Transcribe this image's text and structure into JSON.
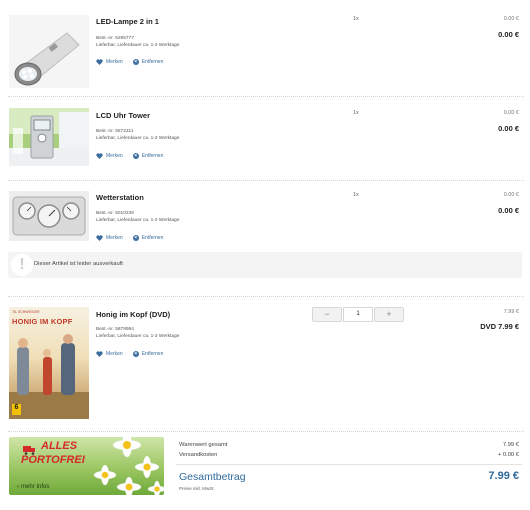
{
  "items": [
    {
      "title": "LED-Lampe 2 in 1",
      "order_no": "Best.-nr. 5285777",
      "delivery": "Lieferbar, Lieferdauer ca. 1-2 Werktage",
      "qty": "1x",
      "unit_price": "0.00 €",
      "total": "0.00 €"
    },
    {
      "title": "LCD Uhr Tower",
      "order_no": "Best.-nr. 5572311",
      "delivery": "Lieferbar, Lieferdauer ca. 1-2 Werktage",
      "qty": "1x",
      "unit_price": "0.00 €",
      "total": "0.00 €"
    },
    {
      "title": "Wetterstation",
      "order_no": "Best.-nr. 5010236",
      "delivery": "Lieferbar, Lieferdauer ca. 1-2 Werktage",
      "qty": "1x",
      "unit_price": "0.00 €",
      "total": "0.00 €"
    },
    {
      "title": "Honig im Kopf (DVD)",
      "order_no": "Best.-nr. 5878984",
      "delivery": "Lieferbar, Lieferdauer ca. 1-2 Werktage",
      "qty_value": "1",
      "unit_price": "7.99 €",
      "total": "DVD 7.99 €"
    }
  ],
  "actions": {
    "favorite": "Merken",
    "remove": "Entfernen"
  },
  "soldout_text": "Dieser Artikel ist leider ausverkauft",
  "stepper": {
    "minus": "−",
    "plus": "+"
  },
  "dvd_cover": {
    "small_top": "TIL SCHWEIGER",
    "title": "HONIG IM KOPF",
    "age": "6"
  },
  "banner": {
    "headline_1": "ALLES",
    "headline_2": "PORTOFREI",
    "link": "mehr Infos"
  },
  "summary": {
    "goods_label": "Warenwert gesamt",
    "goods_value": "7.99 €",
    "shipping_label": "Versandkosten",
    "shipping_value": "+ 0.00 €",
    "total_label": "Gesamtbetrag",
    "total_value": "7.99 €",
    "tax_note": "Preise inkl. MwSt."
  },
  "colors": {
    "link": "#3b6c9e",
    "total": "#2f6a9c",
    "banner_red": "#d32a2a"
  }
}
